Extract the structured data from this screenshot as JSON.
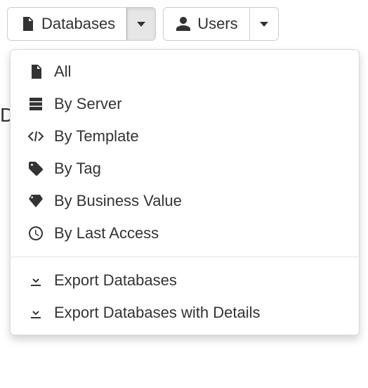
{
  "toolbar": {
    "databases_label": "Databases",
    "users_label": "Users"
  },
  "menu": {
    "all": "All",
    "by_server": "By Server",
    "by_template": "By Template",
    "by_tag": "By Tag",
    "by_business_value": "By Business Value",
    "by_last_access": "By Last Access",
    "export_databases": "Export Databases",
    "export_databases_details": "Export Databases with Details"
  }
}
